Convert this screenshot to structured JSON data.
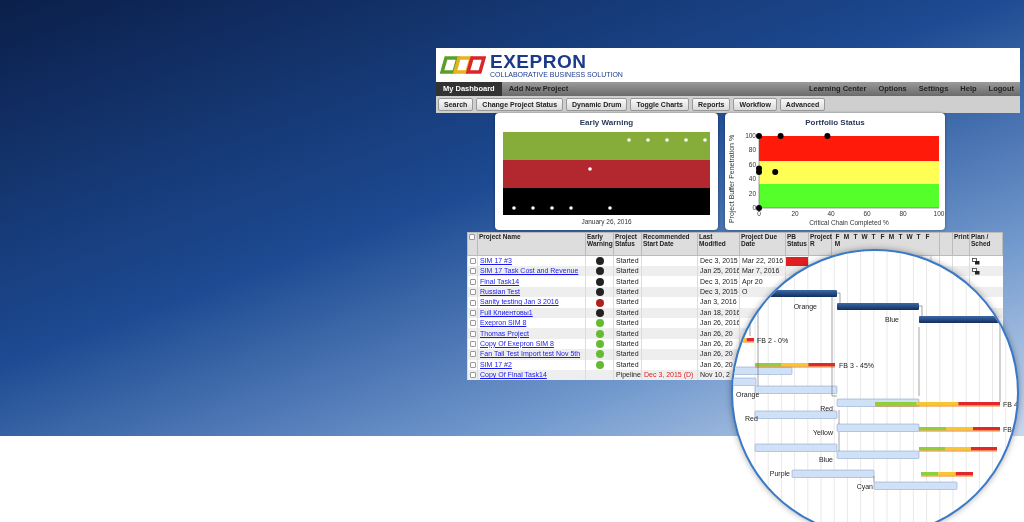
{
  "logo": {
    "name": "EXEPRON",
    "tagline": "COLLABORATIVE BUSINESS SOLUTION"
  },
  "nav": {
    "tabs": [
      {
        "label": "My Dashboard",
        "selected": true
      },
      {
        "label": "Add New Project",
        "selected": false
      }
    ],
    "links": [
      "Learning Center",
      "Options",
      "Settings",
      "Help",
      "Logout"
    ]
  },
  "toolbar": [
    "Search",
    "Change Project Status",
    "Dynamic Drum",
    "Toggle Charts",
    "Reports",
    "Workflow",
    "Advanced"
  ],
  "early_warning": {
    "title": "Early Warning",
    "date": "January 26, 2016"
  },
  "portfolio_status": {
    "chart_data": {
      "type": "scatter",
      "title": "Portfolio Status",
      "xlabel": "Critical Chain Completed %",
      "ylabel": "Project Buffer Penetration %",
      "xlim": [
        0,
        100
      ],
      "ylim": [
        0,
        100
      ],
      "xticks": [
        0,
        20,
        40,
        60,
        80,
        100
      ],
      "yticks": [
        0,
        20,
        40,
        60,
        80,
        100
      ],
      "x": [
        0,
        12,
        38,
        0,
        0,
        9,
        0
      ],
      "series": [
        {
          "color": "#000000",
          "values": [
            100,
            100,
            100,
            55,
            50,
            50,
            0
          ]
        }
      ]
    }
  },
  "table": {
    "all_checked": false,
    "columns": [
      "Project Name",
      "Early Warning",
      "Project Status",
      "Recommended Start Date",
      "Last Modified",
      "Project Due Date",
      "PB Status",
      "Project R",
      "Print",
      "Plan / Sched"
    ],
    "day_letters": [
      "F",
      "M",
      "T",
      "W",
      "T",
      "F",
      "M",
      "T",
      "W",
      "T",
      "F",
      "M"
    ],
    "rows": [
      {
        "checked": false,
        "name": "SIM 17 #3",
        "color": "#222222",
        "status": "Started",
        "last_modified": "Dec 3, 2015",
        "due_date": "Mar 22, 2016",
        "pb_status": {
          "color": "#e02020"
        },
        "plan_icon": true
      },
      {
        "checked": false,
        "name": "SIM 17 Task Cost and Revenue",
        "color": "#222222",
        "status": "Started",
        "last_modified": "Jan 25, 2016",
        "due_date": "Mar 7, 2016",
        "plan_icon": true
      },
      {
        "checked": false,
        "name": "Final Task14",
        "color": "#222222",
        "status": "Started",
        "last_modified": "Dec 3, 2015",
        "due_date": "Apr 20",
        "plan_icon": false
      },
      {
        "checked": false,
        "name": "Russian Test",
        "color": "#222222",
        "status": "Started",
        "last_modified": "Dec 3, 2015",
        "due_date": "O",
        "plan_icon": false
      },
      {
        "checked": false,
        "name": "Sanity testing Jan 3 2016",
        "color": "#b02020",
        "status": "Started",
        "last_modified": "Jan 3, 2016",
        "plan_icon": false
      },
      {
        "checked": false,
        "name": "Full Клиентовы1",
        "color": "#222222",
        "status": "Started",
        "last_modified": "Jan 18, 2016",
        "plan_icon": false
      },
      {
        "checked": false,
        "name": "Exepron SIM 8",
        "color": "#66bb33",
        "status": "Started",
        "last_modified": "Jan 26, 2016",
        "plan_icon": false
      },
      {
        "checked": false,
        "name": "Thomas Project",
        "color": "#66bb33",
        "status": "Started",
        "last_modified": "Jan 26, 20",
        "plan_icon": false
      },
      {
        "checked": false,
        "name": "Copy Of Exepron SIM 8",
        "color": "#66bb33",
        "status": "Started",
        "last_modified": "Jan 26, 20",
        "plan_icon": false
      },
      {
        "checked": false,
        "name": "Fan Tail Test Import test Nov 5th",
        "color": "#66bb33",
        "status": "Started",
        "last_modified": "Jan 26, 20",
        "plan_icon": false
      },
      {
        "checked": false,
        "name": "SIM 17 #2",
        "color": "#66bb33",
        "status": "Started",
        "last_modified": "Jan 26, 20",
        "plan_icon": false
      },
      {
        "checked": false,
        "name": "Copy Of Final Task14",
        "status": "Pipeline",
        "recommended_start": "Dec 3, 2015 (D)",
        "last_modified": "Nov 10, 2",
        "plan_icon": false
      }
    ]
  },
  "magnifier": {
    "labels": [
      "Orange",
      "Blue",
      "FB 2 - 0%",
      "FB 3 - 45%",
      "Orange",
      "Red",
      "FB 4",
      "Red",
      "Yellow",
      "FB",
      "Blue",
      "Purple",
      "Cyan"
    ]
  }
}
